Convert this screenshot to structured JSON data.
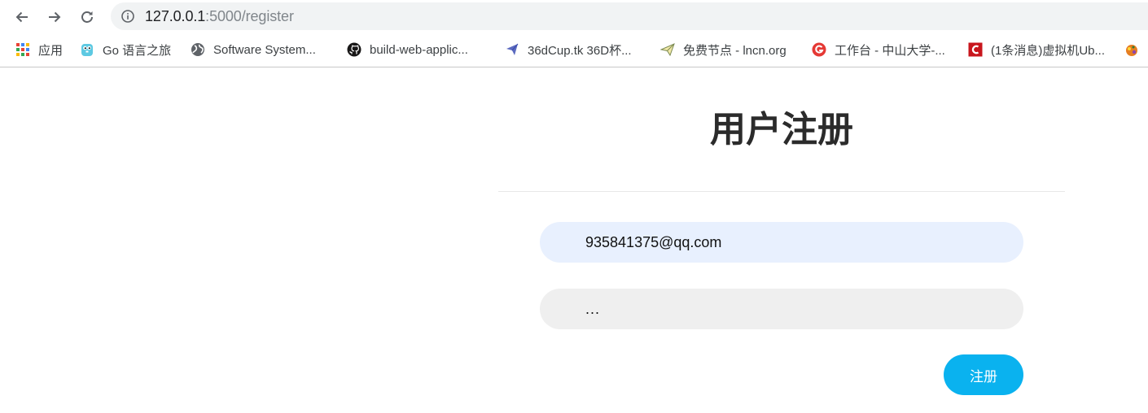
{
  "browser": {
    "address_bar": {
      "host": "127.0.0.1",
      "path": ":5000/register"
    },
    "bookmarks": [
      {
        "label": "应用",
        "icon": "apps-grid-icon"
      },
      {
        "label": "Go 语言之旅",
        "icon": "gopher-icon"
      },
      {
        "label": "Software System...",
        "icon": "globe-icon"
      },
      {
        "label": "build-web-applic...",
        "icon": "github-icon"
      },
      {
        "label": "36dCup.tk 36D杯...",
        "icon": "paper-plane-icon"
      },
      {
        "label": "免费节点 - lncn.org",
        "icon": "send-icon"
      },
      {
        "label": "工作台 - 中山大学-...",
        "icon": "g-logo-icon"
      },
      {
        "label": "(1条消息)虚拟机Ub...",
        "icon": "csdn-icon"
      },
      {
        "label": "",
        "icon": "game-icon"
      }
    ]
  },
  "page": {
    "title": "用户注册",
    "email_value": "935841375@qq.com",
    "password_value": "...",
    "submit_label": "注册"
  },
  "colors": {
    "submit_button": "#0ab2ef",
    "email_field_bg": "#e8f0fe",
    "password_field_bg": "#efefef"
  }
}
